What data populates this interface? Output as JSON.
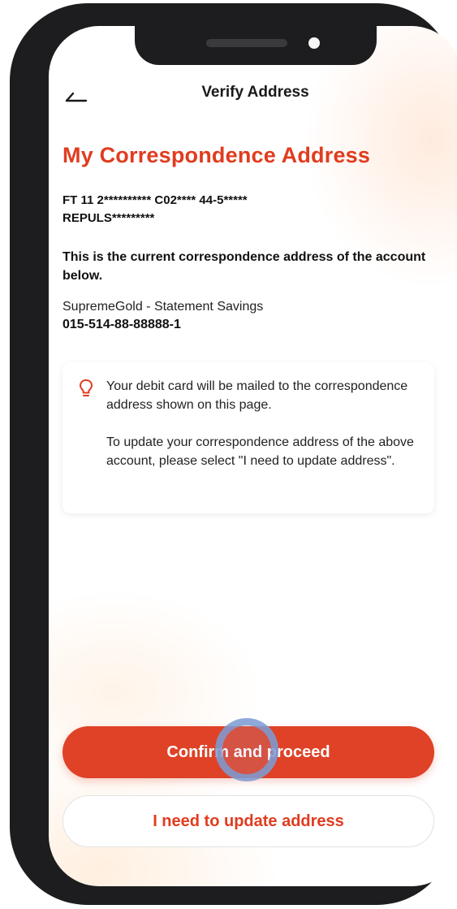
{
  "header": {
    "title": "Verify Address",
    "back_icon": "back-arrow-icon"
  },
  "page": {
    "title": "My Correspondence Address",
    "masked_address_line1": "FT 11 2********** C02**** 44-5*****",
    "masked_address_line2": "REPULS*********",
    "description": "This is the current correspondence address of the account below.",
    "account_name": "SupremeGold - Statement Savings",
    "account_number": "015-514-88-88888-1"
  },
  "info_card": {
    "icon": "lightbulb-icon",
    "line1": "Your debit card will be mailed to the correspondence address shown on this page.",
    "line2": "To update your correspondence address of the above account, please select \"I need to update address\"."
  },
  "actions": {
    "confirm_label": "Confirm and proceed",
    "update_label": "I need to update address"
  },
  "colors": {
    "accent": "#e03c1f",
    "primary_button": "#df4227",
    "device_frame": "#1d1d1f"
  }
}
